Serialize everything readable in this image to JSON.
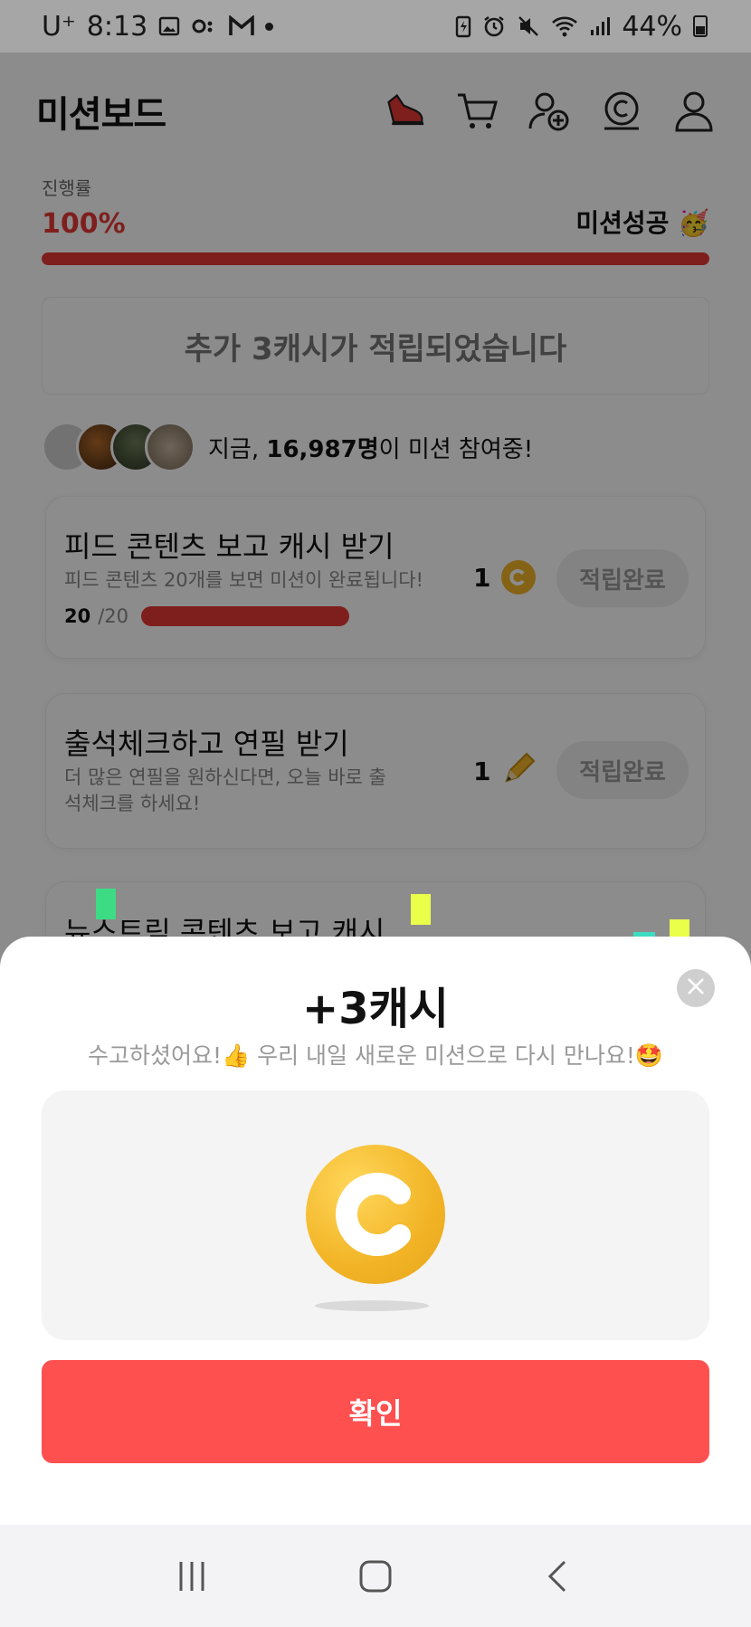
{
  "status_bar": {
    "carrier": "U⁺",
    "time": "8:13",
    "battery": "44%"
  },
  "header": {
    "title": "미션보드"
  },
  "progress": {
    "label": "진행률",
    "value": "100%",
    "fraction": 1.0,
    "success_text": "미션성공 🥳"
  },
  "banner": {
    "text": "추가 3캐시가 적립되었습니다"
  },
  "participants": {
    "prefix": "지금, ",
    "count": "16,987명",
    "suffix": "이 미션 참여중!"
  },
  "missions": [
    {
      "title": "피드 콘텐츠 보고 캐시 받기",
      "desc": "피드 콘텐츠 20개를 보면 미션이 완료됩니다!",
      "progress_done": "20",
      "progress_total": "/20",
      "reward_amount": "1",
      "reward_icon": "coin-icon",
      "button": "적립완료"
    },
    {
      "title": "출석체크하고 연필 받기",
      "desc": "더 많은 연필을 원하신다면, 오늘 바로 출석체크를 하세요!",
      "reward_amount": "1",
      "reward_icon": "pencil-icon",
      "button": "적립완료"
    },
    {
      "title": "뉴스트림 콘텐츠 보고 캐시"
    }
  ],
  "sheet": {
    "title": "+3캐시",
    "subtitle": "수고하셨어요!👍 우리 내일 새로운 미션으로 다시 만나요!🤩",
    "confirm": "확인"
  },
  "colors": {
    "accent": "#e53935",
    "confirm": "#ff5050",
    "coin": "#f2b426"
  }
}
